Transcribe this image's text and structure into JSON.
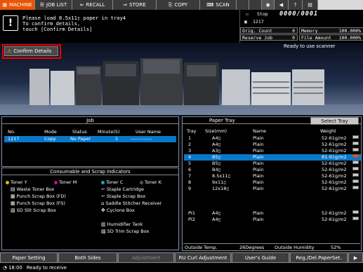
{
  "tabs": [
    {
      "label": "MACHINE",
      "icon": "machine-icon",
      "active": true
    },
    {
      "label": "JOB LIST",
      "icon": "list-icon",
      "active": false
    },
    {
      "label": "RECALL",
      "icon": "recall-icon",
      "active": false
    },
    {
      "label": "STORE",
      "icon": "store-icon",
      "active": false
    },
    {
      "label": "COPY",
      "icon": "copy-icon",
      "active": false
    },
    {
      "label": "SCAN",
      "icon": "scan-icon",
      "active": false
    }
  ],
  "message": {
    "line1": "Please load   8.5x11▯  paper in tray4",
    "line2": "To confirm details,",
    "line3": "touch [Confirm Details]"
  },
  "status": {
    "stop_label": "Stop",
    "counter": "0000/0001",
    "job_number": "1217",
    "orig_count_label": "Orig. Count",
    "orig_count": "0",
    "memory_label": "Memory",
    "memory": "100.000%",
    "reserve_job_label": "Reserve Job",
    "reserve_job": "0",
    "file_amount_label": "File Amount",
    "file_amount": "100.000%"
  },
  "confirm_details_label": "Confirm Details",
  "scanner_status": "Ready to use scanner",
  "job_panel": {
    "title": "Job",
    "headers": [
      "No.",
      "Mode",
      "Status",
      "Minute(S)",
      "User Name"
    ],
    "rows": [
      {
        "no": "1217",
        "mode": "Copy",
        "status": "No Paper",
        "minute": "1",
        "user": "-------------"
      }
    ]
  },
  "consumables": {
    "title": "Consumable and Scrap Indicators",
    "items": [
      {
        "label": "Toner Y"
      },
      {
        "label": "Toner M"
      },
      {
        "label": "Toner C"
      },
      {
        "label": "Toner K"
      },
      {
        "label": "Waste Toner Box"
      },
      {
        "label": "Staple Cartridge"
      },
      {
        "label": "Punch Scrap Box (FD)"
      },
      {
        "label": "Staple Scrap Box"
      },
      {
        "label": "Punch Scrap Box (FS)"
      },
      {
        "label": "Saddle Stitcher Receiver"
      },
      {
        "label": "SD Slit Scrap Box"
      },
      {
        "label": "Cyclone Box"
      },
      {
        "label": "Humidifier Tank"
      },
      {
        "label": "SD Trim Scrap Box"
      }
    ]
  },
  "tray_panel": {
    "title": "Paper Tray",
    "select_label": "Select Tray",
    "headers": [
      "Tray",
      "Size(mm)",
      "Name",
      "Weight"
    ],
    "rows": [
      {
        "tray": "1",
        "size": "A4▯",
        "name": "Plain",
        "weight": "52-61g/m2"
      },
      {
        "tray": "2",
        "size": "A4▯",
        "name": "Plain",
        "weight": "52-61g/m2"
      },
      {
        "tray": "3",
        "size": "A3▯",
        "name": "Plain",
        "weight": "52-61g/m2"
      },
      {
        "tray": "4",
        "size": "B5▯",
        "name": "Plain",
        "weight": "81-91g/m2"
      },
      {
        "tray": "5",
        "size": "B5▯",
        "name": "Plain",
        "weight": "52-61g/m2"
      },
      {
        "tray": "6",
        "size": "B4▯",
        "name": "Plain",
        "weight": "52-61g/m2"
      },
      {
        "tray": "7",
        "size": "8.5x11▯",
        "name": "Plain",
        "weight": "52-61g/m2"
      },
      {
        "tray": "8",
        "size": "9x11▯",
        "name": "Plain",
        "weight": "52-61g/m2"
      },
      {
        "tray": "9",
        "size": "12x18▯",
        "name": "Plain",
        "weight": "52-61g/m2"
      },
      {
        "tray": "PI1",
        "size": "A4▯",
        "name": "Plain",
        "weight": "52-61g/m2"
      },
      {
        "tray": "PI2",
        "size": "A4▯",
        "name": "Plain",
        "weight": "52-61g/m2"
      }
    ],
    "outside_temp_label": "Outside Temp.",
    "outside_temp": "26Degrees",
    "outside_humidity_label": "Outside Humidity",
    "outside_humidity": "52%"
  },
  "bottom_buttons": [
    {
      "label": "Paper Setting"
    },
    {
      "label": "Both Sides"
    },
    {
      "label": "Adjustment"
    },
    {
      "label": "RU Curl Adjustment"
    },
    {
      "label": "User's Guide"
    },
    {
      "label": "Reg./Del.PaperSet."
    }
  ],
  "status_line": {
    "time": "18:00",
    "text": "Ready to receive"
  },
  "colors": {
    "accent": "#e8550a",
    "selected": "#0a77c8",
    "alert_border": "#ee0000"
  }
}
